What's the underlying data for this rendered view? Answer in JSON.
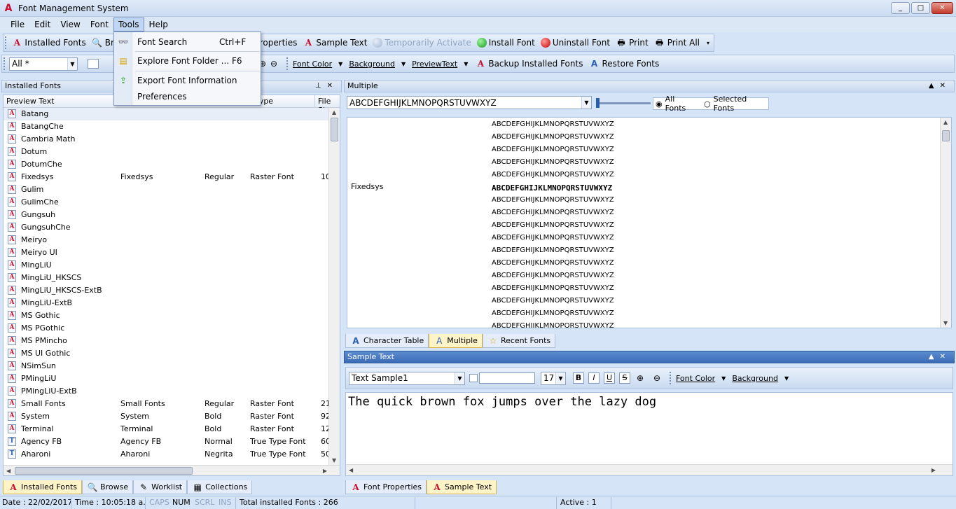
{
  "window": {
    "title": "Font Management System",
    "controls": [
      "_",
      "□",
      "✕"
    ]
  },
  "menubar": [
    "File",
    "Edit",
    "View",
    "Font",
    "Tools",
    "Help"
  ],
  "tools_menu": {
    "items": [
      {
        "label": "Font Search",
        "shortcut": "Ctrl+F",
        "icon": "binoculars-icon"
      },
      {
        "label": "Explore Font Folder ...",
        "shortcut": "F6",
        "icon": "folder-icon"
      },
      {
        "label": "Export Font Information",
        "shortcut": "",
        "icon": "export-icon"
      },
      {
        "label": "Preferences",
        "shortcut": "",
        "icon": ""
      }
    ]
  },
  "toolbar1": {
    "installed_fonts": "Installed Fonts",
    "browse": "Brows",
    "font_properties": "ont Properties",
    "sample_text": "Sample Text",
    "temporarily_activate": "Temporarily Activate",
    "install_font": "Install Font",
    "uninstall_font": "Uninstall Font",
    "print": "Print",
    "print_all": "Print All"
  },
  "toolbar2": {
    "filter_value": "All *",
    "font_color": "Font Color",
    "background": "Background",
    "preview_text": "PreviewText",
    "backup": "Backup Installed Fonts",
    "restore": "Restore Fonts"
  },
  "left_pane": {
    "title": "Installed Fonts",
    "columns": [
      "Preview Text",
      "t Type",
      "File Siz"
    ],
    "rows": [
      {
        "preview": "Batang",
        "name": "",
        "style": "",
        "type": "",
        "size": "",
        "icon": "red"
      },
      {
        "preview": "BatangChe",
        "name": "",
        "style": "",
        "type": "",
        "size": "",
        "icon": "red"
      },
      {
        "preview": "Cambria Math",
        "name": "",
        "style": "",
        "type": "",
        "size": "",
        "icon": "red"
      },
      {
        "preview": "Dotum",
        "name": "",
        "style": "",
        "type": "",
        "size": "",
        "icon": "red"
      },
      {
        "preview": "DotumChe",
        "name": "",
        "style": "",
        "type": "",
        "size": "",
        "icon": "red"
      },
      {
        "preview": "Fixedsys",
        "name": "Fixedsys",
        "style": "Regular",
        "type": "Raster Font",
        "size": "10",
        "icon": "red"
      },
      {
        "preview": "Gulim",
        "name": "",
        "style": "",
        "type": "",
        "size": "",
        "icon": "red"
      },
      {
        "preview": "GulimChe",
        "name": "",
        "style": "",
        "type": "",
        "size": "",
        "icon": "red"
      },
      {
        "preview": "Gungsuh",
        "name": "",
        "style": "",
        "type": "",
        "size": "",
        "icon": "red"
      },
      {
        "preview": "GungsuhChe",
        "name": "",
        "style": "",
        "type": "",
        "size": "",
        "icon": "red"
      },
      {
        "preview": "Meiryo",
        "name": "",
        "style": "",
        "type": "",
        "size": "",
        "icon": "red"
      },
      {
        "preview": "Meiryo UI",
        "name": "",
        "style": "",
        "type": "",
        "size": "",
        "icon": "red"
      },
      {
        "preview": "MingLiU",
        "name": "",
        "style": "",
        "type": "",
        "size": "",
        "icon": "red"
      },
      {
        "preview": "MingLiU_HKSCS",
        "name": "",
        "style": "",
        "type": "",
        "size": "",
        "icon": "red"
      },
      {
        "preview": "MingLiU_HKSCS-ExtB",
        "name": "",
        "style": "",
        "type": "",
        "size": "",
        "icon": "red"
      },
      {
        "preview": "MingLiU-ExtB",
        "name": "",
        "style": "",
        "type": "",
        "size": "",
        "icon": "red"
      },
      {
        "preview": "MS Gothic",
        "name": "",
        "style": "",
        "type": "",
        "size": "",
        "icon": "red"
      },
      {
        "preview": "MS PGothic",
        "name": "",
        "style": "",
        "type": "",
        "size": "",
        "icon": "red"
      },
      {
        "preview": "MS PMincho",
        "name": "",
        "style": "",
        "type": "",
        "size": "",
        "icon": "red"
      },
      {
        "preview": "MS UI Gothic",
        "name": "",
        "style": "",
        "type": "",
        "size": "",
        "icon": "red"
      },
      {
        "preview": "NSimSun",
        "name": "",
        "style": "",
        "type": "",
        "size": "",
        "icon": "red"
      },
      {
        "preview": "PMingLiU",
        "name": "",
        "style": "",
        "type": "",
        "size": "",
        "icon": "red"
      },
      {
        "preview": "PMingLiU-ExtB",
        "name": "",
        "style": "",
        "type": "",
        "size": "",
        "icon": "red"
      },
      {
        "preview": "Small Fonts",
        "name": "Small Fonts",
        "style": "Regular",
        "type": "Raster Font",
        "size": "21",
        "icon": "red"
      },
      {
        "preview": "System",
        "name": "System",
        "style": "Bold",
        "type": "Raster Font",
        "size": "92",
        "icon": "red"
      },
      {
        "preview": "Terminal",
        "name": "Terminal",
        "style": "Bold",
        "type": "Raster Font",
        "size": "12",
        "icon": "red"
      },
      {
        "preview": "Agency FB",
        "name": "Agency FB",
        "style": "Normal",
        "type": "True Type Font",
        "size": "60",
        "icon": "blue"
      },
      {
        "preview": "Aharoni",
        "name": "Aharoni",
        "style": "Negrita",
        "type": "True Type Font",
        "size": "50",
        "icon": "blue"
      }
    ],
    "tabs": [
      "Installed Fonts",
      "Browse",
      "Worklist",
      "Collections"
    ]
  },
  "multiple_pane": {
    "title": "Multiple",
    "preview_text": "ABCDEFGHIJKLMNOPQRSTUVWXYZ",
    "radio_all": "All Fonts",
    "radio_selected": "Selected Fonts",
    "highlight_label": "Fixedsys",
    "sample": "ABCDEFGHIJKLMNOPQRSTUVWXYZ",
    "tabs": [
      "Character Table",
      "Multiple",
      "Recent Fonts"
    ]
  },
  "sample_pane": {
    "title": "Sample Text",
    "combo_value": "Text Sample1",
    "size_value": "17",
    "format_buttons": [
      "B",
      "I",
      "U",
      "S"
    ],
    "font_color": "Font Color",
    "background": "Background",
    "text": "The quick brown fox jumps over the lazy dog",
    "tabs": [
      "Font Properties",
      "Sample Text"
    ]
  },
  "statusbar": {
    "date": "Date : 22/02/2017",
    "time": "Time : 10:05:18 a.m",
    "caps": "CAPS",
    "num": "NUM",
    "scrl": "SCRL",
    "ins": "INS",
    "total": "Total installed Fonts : 266",
    "active": "Active : 1"
  }
}
